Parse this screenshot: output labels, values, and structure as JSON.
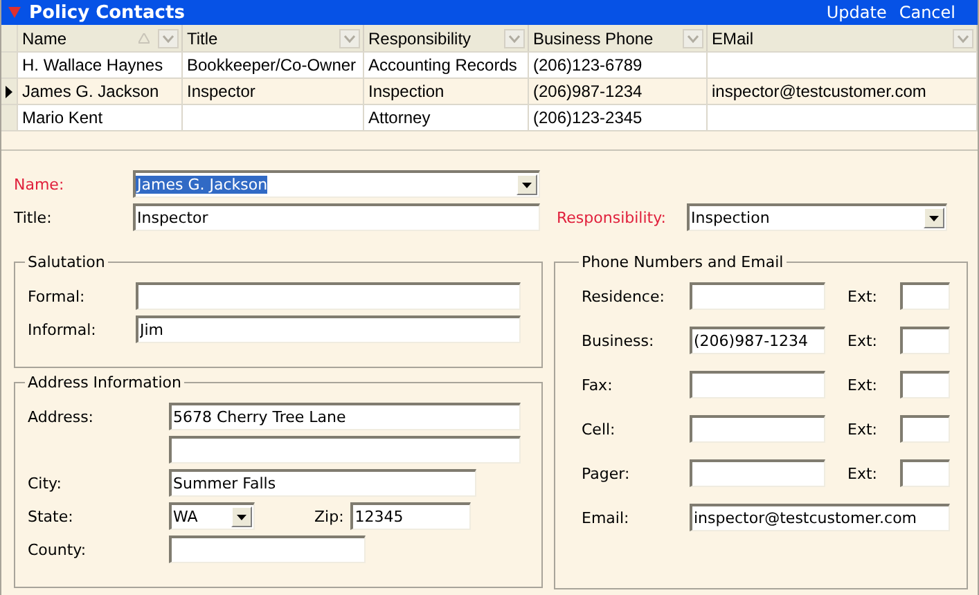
{
  "panel": {
    "title": "Policy Contacts",
    "actions": [
      "Update",
      "Cancel"
    ]
  },
  "grid": {
    "columns": [
      {
        "label": "Name",
        "sorted_ascending": true
      },
      {
        "label": "Title"
      },
      {
        "label": "Responsibility"
      },
      {
        "label": "Business Phone"
      },
      {
        "label": "EMail"
      }
    ],
    "rows": [
      {
        "selected": false,
        "cells": [
          "H. Wallace Haynes",
          "Bookkeeper/Co-Owner",
          "Accounting Records",
          "(206)123-6789",
          ""
        ]
      },
      {
        "selected": true,
        "cells": [
          "James G. Jackson",
          "Inspector",
          "Inspection",
          "(206)987-1234",
          "inspector@testcustomer.com"
        ]
      },
      {
        "selected": false,
        "cells": [
          "Mario Kent",
          "",
          "Attorney",
          "(206)123-2345",
          ""
        ]
      }
    ]
  },
  "name": {
    "label": "Name:",
    "value": "James G. Jackson",
    "required": true,
    "highlighted": true
  },
  "title": {
    "label": "Title:",
    "value": "Inspector",
    "required": false
  },
  "responsibility": {
    "label": "Responsibility:",
    "value": "Inspection",
    "required": true
  },
  "salutation": {
    "title": "Salutation",
    "fields": [
      {
        "label": "Formal:"
      },
      {
        "label": "Informal:",
        "value": "Jim"
      }
    ]
  },
  "address": {
    "title": "Address Information",
    "label": "Address:",
    "value": "5678 Cherry Tree Lane",
    "city": {
      "label": "City:",
      "value": "Summer Falls"
    },
    "state": {
      "label": "State:",
      "value": "WA"
    },
    "zip": {
      "label": "Zip:",
      "value": "12345"
    },
    "county": {
      "label": "County:"
    }
  },
  "phones": {
    "title": "Phone Numbers and Email",
    "rows": [
      {
        "label": "Residence:",
        "ext_label": "Ext:"
      },
      {
        "label": "Business:",
        "value": "(206)987-1234",
        "ext_label": "Ext:"
      },
      {
        "label": "Fax:",
        "ext_label": "Ext:"
      },
      {
        "label": "Cell:",
        "ext_label": "Ext:"
      },
      {
        "label": "Pager:",
        "ext_label": "Ext:"
      }
    ],
    "email": {
      "label": "Email:",
      "value": "inspector@testcustomer.com"
    }
  }
}
